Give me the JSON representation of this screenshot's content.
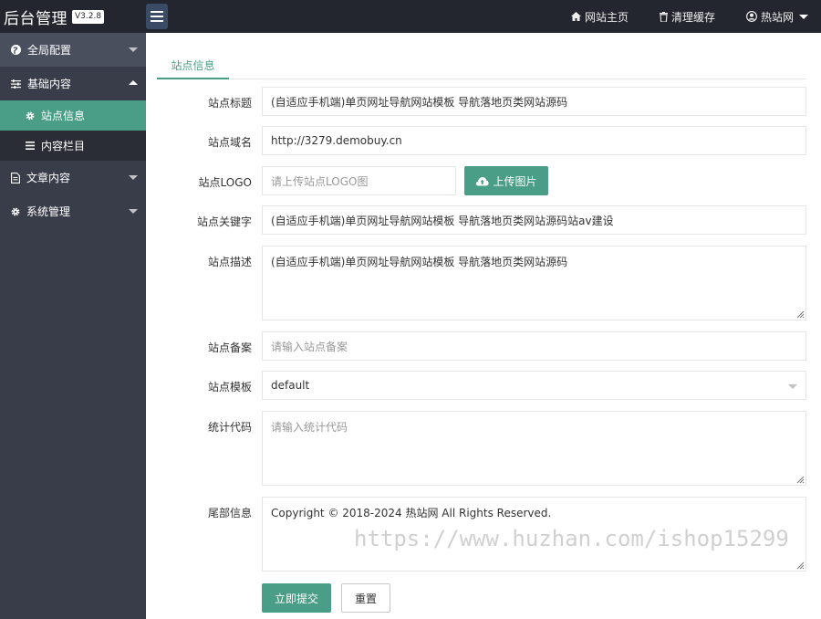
{
  "header": {
    "brand_title": "后台管理",
    "version": "V3.2.8",
    "nav": {
      "home_label": "网站主页",
      "clear_cache_label": "清理缓存",
      "user_label": "热站网"
    }
  },
  "sidebar": {
    "items": [
      {
        "label": "全局配置",
        "icon": "globe-icon"
      },
      {
        "label": "基础内容",
        "icon": "sliders-icon"
      },
      {
        "label": "文章内容",
        "icon": "file-icon"
      },
      {
        "label": "系统管理",
        "icon": "gear-icon"
      }
    ],
    "sub_items": [
      {
        "label": "站点信息",
        "icon": "gear-icon",
        "active": true
      },
      {
        "label": "内容栏目",
        "icon": "list-icon",
        "active": false
      }
    ]
  },
  "tab": {
    "label": "站点信息"
  },
  "form": {
    "title": {
      "label": "站点标题",
      "value": "(自适应手机端)单页网址导航网站模板 导航落地页类网站源码"
    },
    "domain": {
      "label": "站点域名",
      "value": "http://3279.demobuy.cn"
    },
    "logo": {
      "label": "站点LOGO",
      "placeholder": "请上传站点LOGO图",
      "upload_label": "上传图片"
    },
    "keywords": {
      "label": "站点关键字",
      "value": "(自适应手机端)单页网址导航网站模板 导航落地页类网站源码站av建设"
    },
    "description": {
      "label": "站点描述",
      "value": "(自适应手机端)单页网址导航网站模板 导航落地页类网站源码"
    },
    "icp": {
      "label": "站点备案",
      "placeholder": "请输入站点备案"
    },
    "template": {
      "label": "站点模板",
      "value": "default"
    },
    "stats": {
      "label": "统计代码",
      "placeholder": "请输入统计代码"
    },
    "footer": {
      "label": "尾部信息",
      "value": "Copyright © 2018-2024 热站网 All Rights Reserved."
    },
    "submit_label": "立即提交",
    "reset_label": "重置"
  },
  "watermark": "https://www.huzhan.com/ishop15299",
  "colors": {
    "accent": "#4a9e87",
    "header_bg": "#23262e",
    "sidebar_bg": "#393d49",
    "submenu_bg": "#2a2d35"
  }
}
